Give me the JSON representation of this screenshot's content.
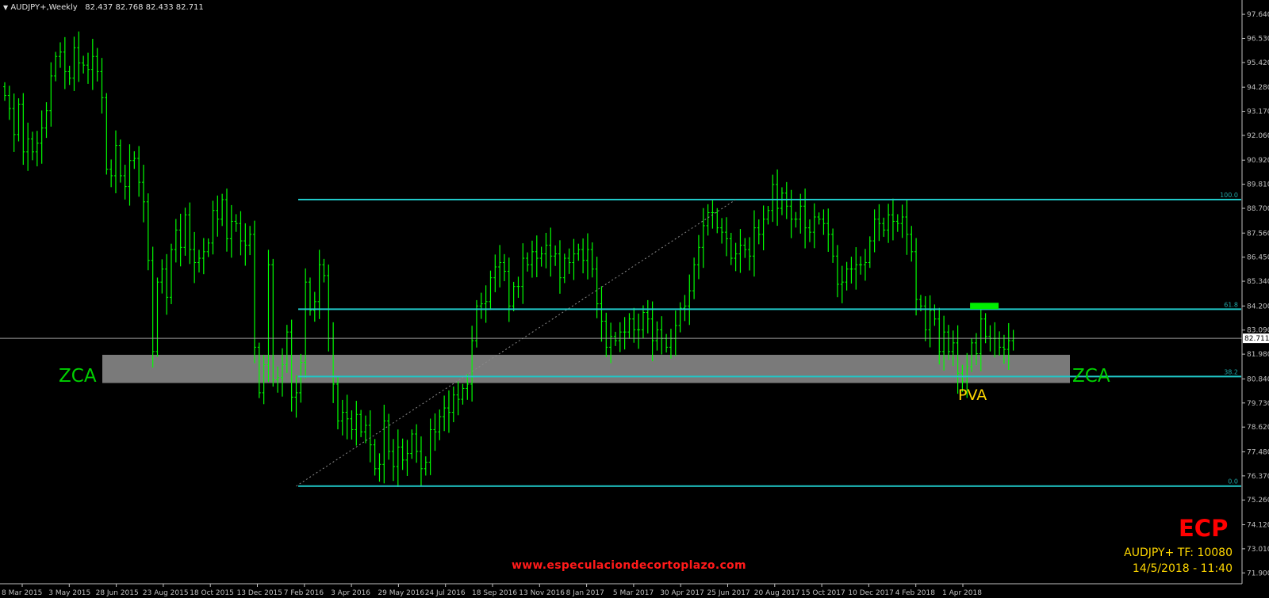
{
  "header": {
    "menu_arrow": "▼",
    "symbol_tf": "AUDJPY+,Weekly",
    "ohlc": "82.437 82.768 82.433 82.711"
  },
  "colors": {
    "background": "#000000",
    "bar": "#00ff00",
    "fib_line": "#20c8c8",
    "fib_label": "#20a8a8",
    "axis": "#c0c0c0",
    "zone_fill": "#7a7a7a",
    "zca": "#00d000",
    "pva": "#ffd700",
    "brand_red": "#ff0000",
    "info_yellow": "#ffd700",
    "green_marker": "#00ee00",
    "price_line": "#9a9a9a"
  },
  "chart_data": {
    "type": "ohlc",
    "title": "AUDJPY+,Weekly",
    "timeframe": "Weekly",
    "ylim": [
      71.4,
      98.3
    ],
    "y_ticks": [
      "97.640",
      "96.530",
      "95.420",
      "94.280",
      "93.170",
      "92.060",
      "90.920",
      "89.810",
      "88.700",
      "87.560",
      "86.450",
      "85.340",
      "84.200",
      "83.090",
      "81.980",
      "80.840",
      "79.730",
      "78.620",
      "77.480",
      "76.370",
      "75.260",
      "74.120",
      "73.010",
      "71.900"
    ],
    "x_ticks": [
      "8 Mar 2015",
      "3 May 2015",
      "28 Jun 2015",
      "23 Aug 2015",
      "18 Oct 2015",
      "13 Dec 2015",
      "7 Feb 2016",
      "3 Apr 2016",
      "29 May 2016",
      "24 Jul 2016",
      "18 Sep 2016",
      "13 Nov 2016",
      "8 Jan 2017",
      "5 Mar 2017",
      "30 Apr 2017",
      "25 Jun 2017",
      "20 Aug 2017",
      "15 Oct 2017",
      "10 Dec 2017",
      "4 Feb 2018",
      "1 Apr 2018"
    ],
    "current_price": "82.711",
    "fib_levels": [
      {
        "label": "100.0",
        "value": 89.1
      },
      {
        "label": "61.8",
        "value": 84.05
      },
      {
        "label": "38.2",
        "value": 80.95
      },
      {
        "label": "0.0",
        "value": 75.9
      }
    ],
    "zone": {
      "top": 81.95,
      "bottom": 80.65
    },
    "trendline": {
      "from_index": 63,
      "from_value": 75.9,
      "to_index": 158,
      "to_value": 89.1
    },
    "target_marker": {
      "index": 209,
      "value": 84.2
    },
    "closes": [
      93.9,
      93.3,
      92.1,
      93.5,
      91.3,
      91.9,
      91.3,
      91.7,
      92.4,
      93.2,
      94.8,
      95.7,
      95.9,
      95.0,
      94.7,
      96.1,
      95.4,
      95.3,
      95.1,
      95.7,
      95.0,
      93.8,
      90.5,
      90.2,
      91.6,
      90.2,
      89.7,
      90.9,
      91.0,
      89.9,
      89.0,
      86.3,
      82.1,
      85.3,
      85.9,
      84.6,
      86.8,
      87.7,
      86.9,
      88.4,
      86.8,
      86.2,
      86.4,
      86.7,
      87.1,
      88.6,
      88.2,
      89.1,
      87.3,
      88.1,
      88.0,
      87.2,
      87.0,
      87.5,
      82.3,
      80.2,
      81.5,
      86.1,
      80.8,
      80.9,
      81.5,
      83.0,
      80.0,
      80.2,
      81.6,
      85.3,
      84.0,
      84.4,
      86.1,
      85.6,
      82.7,
      80.6,
      78.9,
      79.3,
      79.0,
      78.5,
      79.2,
      78.4,
      78.7,
      77.8,
      76.7,
      76.9,
      78.9,
      77.5,
      76.8,
      77.7,
      77.1,
      77.4,
      78.3,
      77.5,
      76.7,
      77.0,
      78.5,
      78.4,
      79.1,
      79.5,
      79.3,
      80.1,
      79.9,
      80.4,
      80.6,
      82.6,
      84.2,
      84.3,
      84.4,
      85.5,
      86.0,
      86.2,
      85.8,
      84.2,
      85.1,
      85.1,
      86.4,
      86.1,
      86.7,
      86.4,
      86.6,
      87.0,
      86.5,
      86.6,
      85.5,
      86.4,
      86.2,
      86.6,
      86.8,
      86.3,
      86.8,
      85.9,
      84.3,
      83.5,
      82.3,
      82.8,
      82.6,
      83.0,
      83.0,
      83.6,
      83.1,
      83.1,
      83.9,
      83.6,
      82.6,
      83.1,
      82.7,
      82.3,
      82.7,
      83.3,
      84.1,
      84.2,
      84.9,
      86.1,
      86.9,
      87.9,
      88.5,
      88.5,
      87.8,
      87.6,
      87.3,
      86.4,
      86.6,
      87.0,
      86.8,
      86.5,
      87.8,
      87.5,
      88.2,
      88.6,
      89.8,
      88.7,
      89.4,
      88.8,
      88.2,
      88.2,
      88.8,
      87.8,
      87.6,
      88.3,
      88.2,
      88.0,
      87.5,
      86.5,
      85.2,
      85.3,
      85.9,
      85.9,
      86.1,
      86.1,
      86.2,
      87.2,
      88.2,
      88.0,
      87.7,
      88.4,
      88.1,
      88.0,
      88.3,
      87.5,
      86.7,
      84.5,
      84.2,
      83.1,
      84.0,
      83.6,
      82.1,
      83.0,
      82.1,
      82.5,
      81.1,
      80.7,
      81.4,
      82.5,
      82.0,
      83.6,
      82.8,
      82.7,
      82.7,
      82.3,
      82.2,
      82.6,
      82.71
    ]
  },
  "annotations": {
    "zca_left": "ZCA",
    "zca_right": "ZCA",
    "pva": "PVA",
    "website": "www.especulaciondecortoplazo.com",
    "brand": "ECP",
    "info_line1": "AUDJPY+ TF: 10080",
    "info_line2": "14/5/2018 - 11:40"
  }
}
